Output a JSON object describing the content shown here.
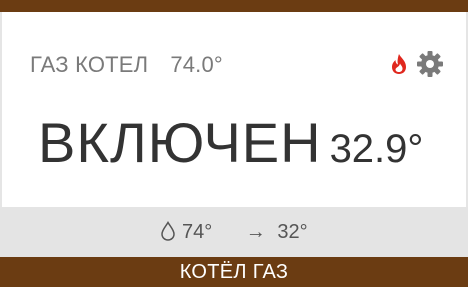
{
  "widget": {
    "title": "ГАЗ КОТЕЛ",
    "setpoint": "74.0°",
    "state": "ВКЛЮЧЕН",
    "current_temp": "32.9°",
    "readings": {
      "supply": "74°",
      "target": "32°"
    },
    "footer_label": "КОТЁЛ ГАЗ",
    "icons": {
      "flame": "flame-icon",
      "settings": "gear-icon",
      "drop": "water-drop-icon",
      "arrow": "arrow-right-icon"
    },
    "colors": {
      "brand": "#6b3c12",
      "flame": "#e0281e",
      "panel": "#e4e4e4"
    }
  }
}
